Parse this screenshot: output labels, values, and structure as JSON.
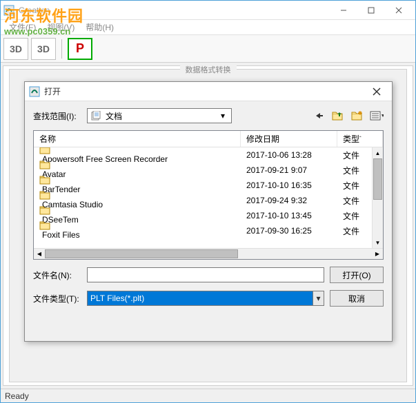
{
  "main": {
    "title": "Creation",
    "menu": {
      "file": "文件(F)",
      "view": "视图(V)",
      "help": "帮助(H)"
    },
    "toolbar": {
      "btn1": "3D",
      "btn2": "3D",
      "btn3": "P"
    },
    "client_caption": "数据格式转换",
    "status": "Ready"
  },
  "watermark": {
    "logo": "河东软件园",
    "url": "www.pc0359.cn"
  },
  "dialog": {
    "title": "打开",
    "lookin_label": "查找范围(I):",
    "lookin_value": "文档",
    "columns": {
      "name": "名称",
      "date": "修改日期",
      "type": "类型"
    },
    "rows": [
      {
        "name": "Apowersoft Free Screen Recorder",
        "date": "2017-10-06 13:28",
        "type": "文件"
      },
      {
        "name": "Avatar",
        "date": "2017-09-21 9:07",
        "type": "文件"
      },
      {
        "name": "BarTender",
        "date": "2017-10-10 16:35",
        "type": "文件"
      },
      {
        "name": "Camtasia Studio",
        "date": "2017-09-24 9:32",
        "type": "文件"
      },
      {
        "name": "DSeeTem",
        "date": "2017-10-10 13:45",
        "type": "文件"
      },
      {
        "name": "Foxit Files",
        "date": "2017-09-30 16:25",
        "type": "文件"
      }
    ],
    "filename_label": "文件名(N):",
    "filename_value": "",
    "filetype_label": "文件类型(T):",
    "filetype_value": "PLT Files(*.plt)",
    "open_button": "打开(O)",
    "cancel_button": "取消"
  }
}
